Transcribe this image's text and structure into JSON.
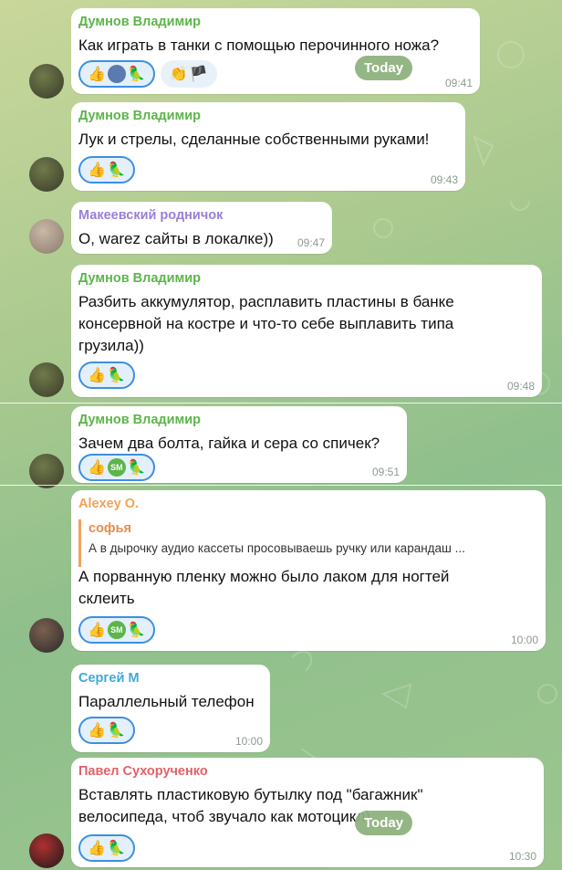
{
  "date_badge": "Today",
  "messages": [
    {
      "sender": "Думнов Владимир",
      "sender_color": "#5cb54a",
      "lines": [
        "Как играть в танки с помощью перочинного ножа?"
      ],
      "time": "09:41",
      "reactions": [
        {
          "icons": [
            "thumbs-up-icon",
            "avatar-mini-icon",
            "parrot-icon"
          ],
          "active": true
        },
        {
          "icons": [
            "clapping-icon",
            "pirate-icon"
          ],
          "active": false
        }
      ]
    },
    {
      "sender": "Думнов Владимир",
      "sender_color": "#5cb54a",
      "lines": [
        "Лук и стрелы, сделанные собственными руками!"
      ],
      "time": "09:43",
      "reactions": [
        {
          "icons": [
            "thumbs-up-icon",
            "parrot-icon"
          ],
          "active": true
        }
      ]
    },
    {
      "sender": "Макеевский родничок",
      "sender_color": "#9a7fd6",
      "lines": [
        "О, warez сайты в локалке))"
      ],
      "time": "09:47",
      "reactions": []
    },
    {
      "sender": "Думнов Владимир",
      "sender_color": "#5cb54a",
      "lines": [
        "Разбить аккумулятор, расплавить пластины в банке",
        "консервной на костре и что-то себе выплавить типа",
        "грузила))"
      ],
      "time": "09:48",
      "reactions": [
        {
          "icons": [
            "thumbs-up-icon",
            "parrot-icon"
          ],
          "active": true
        }
      ]
    },
    {
      "sender": "Думнов Владимир",
      "sender_color": "#5cb54a",
      "lines": [
        "Зачем два болта, гайка и сера со спичек?"
      ],
      "time": "09:51",
      "reactions": [
        {
          "icons": [
            "thumbs-up-icon",
            "sm-icon",
            "parrot-icon"
          ],
          "active": true
        }
      ]
    },
    {
      "sender": "Alexey O.",
      "sender_color": "#f0a35a",
      "reply": {
        "name": "софья",
        "text": "А в дырочку аудио кассеты просовываешь ручку или карандаш ..."
      },
      "lines": [
        "А порванную пленку можно было лаком для ногтей",
        "склеить"
      ],
      "time": "10:00",
      "reactions": [
        {
          "icons": [
            "thumbs-up-icon",
            "sm-icon",
            "parrot-icon"
          ],
          "active": true
        }
      ]
    },
    {
      "sender": "Сергей М",
      "sender_color": "#3fa8d8",
      "lines": [
        "Параллельный телефон"
      ],
      "time": "10:00",
      "reactions": [
        {
          "icons": [
            "thumbs-up-icon",
            "parrot-icon"
          ],
          "active": true
        }
      ]
    },
    {
      "sender": "Павел Сухорученко",
      "sender_color": "#e0626a",
      "lines": [
        "Вставлять пластиковую бутылку под \"багажник\"",
        "велосипеда, чтоб звучало как мотоцикл)"
      ],
      "time": "10:30",
      "reactions": [
        {
          "icons": [
            "thumbs-up-icon",
            "parrot-icon"
          ],
          "active": true
        }
      ]
    }
  ]
}
